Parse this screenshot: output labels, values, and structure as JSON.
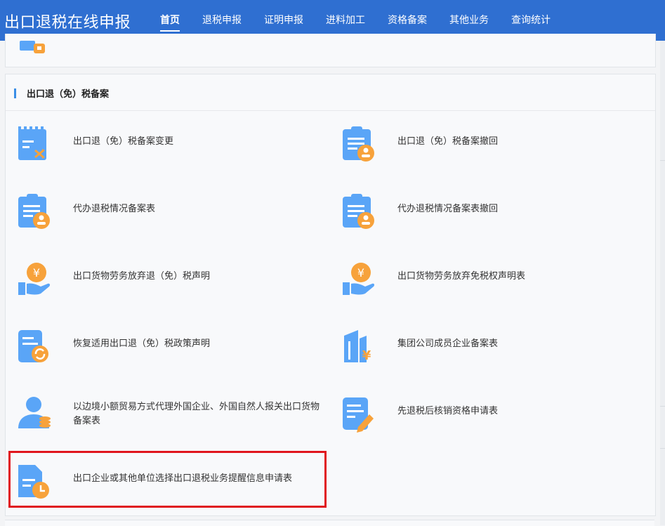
{
  "app": {
    "title": "出口退税在线申报"
  },
  "nav": [
    "首页",
    "退税申报",
    "证明申报",
    "进料加工",
    "资格备案",
    "其他业务",
    "查询统计"
  ],
  "section": {
    "title": "出口退（免）税备案"
  },
  "items": [
    {
      "label": "出口退（免）税备案变更",
      "icon": "calendar-shuffle-icon"
    },
    {
      "label": "出口退（免）税备案撤回",
      "icon": "clipboard-user-icon"
    },
    {
      "label": "代办退税情况备案表",
      "icon": "clipboard-user-icon"
    },
    {
      "label": "代办退税情况备案表撤回",
      "icon": "clipboard-user-icon"
    },
    {
      "label": "出口货物劳务放弃退（免）税声明",
      "icon": "hand-yuan-icon"
    },
    {
      "label": "出口货物劳务放弃免税权声明表",
      "icon": "hand-yuan-icon"
    },
    {
      "label": "恢复适用出口退（免）税政策声明",
      "icon": "document-refresh-icon"
    },
    {
      "label": "集团公司成员企业备案表",
      "icon": "building-yuan-icon"
    },
    {
      "label": "以边境小额贸易方式代理外国企业、外国自然人报关出口货物备案表",
      "icon": "user-coins-icon"
    },
    {
      "label": "先退税后核销资格申请表",
      "icon": "document-pen-icon"
    },
    {
      "label": "出口企业或其他单位选择出口退税业务提醒信息申请表",
      "icon": "document-clock-icon"
    }
  ],
  "colors": {
    "primary": "#2f6fd1",
    "icon_blue": "#5aa5f7",
    "icon_orange": "#f7a23b",
    "highlight": "#e0161e"
  }
}
